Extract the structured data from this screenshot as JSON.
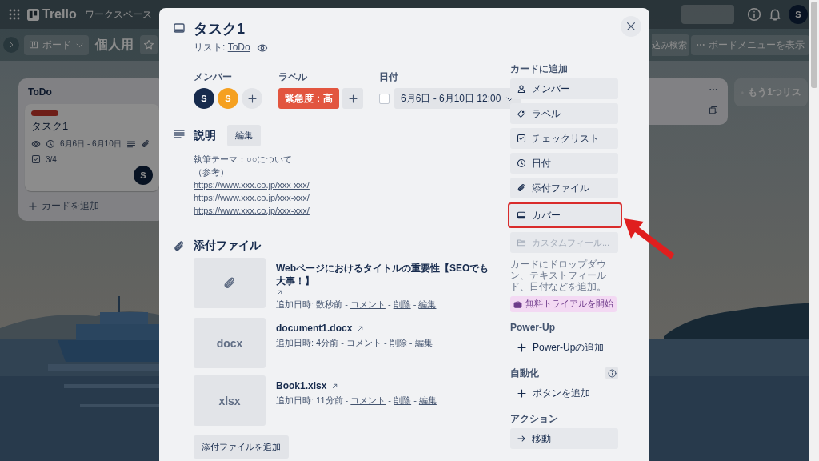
{
  "board": {
    "topbar": {
      "logo": "Trello",
      "workspace": "ワークスペース",
      "avatar": "S"
    },
    "header": {
      "view": "ボード",
      "title": "個人用",
      "filter_button": "込み検索",
      "menu_button": "ボードメニューを表示"
    },
    "lists": [
      {
        "title": "ToDo",
        "cards": [
          {
            "title": "タスク1",
            "dates": "6月6日 - 6月10日",
            "checklist": "3/4",
            "member": "S"
          }
        ],
        "add_card": "カードを追加"
      }
    ],
    "add_list": "もう1つリス"
  },
  "card_dialog": {
    "title": "タスク1",
    "list_prefix": "リスト: ",
    "list_name": "ToDo",
    "members_label": "メンバー",
    "members": [
      {
        "initial": "S",
        "color": "#172b4d"
      },
      {
        "initial": "S",
        "color": "#f5a020"
      }
    ],
    "labels_label": "ラベル",
    "labels": [
      {
        "text": "緊急度：高",
        "color": "#e2553f"
      }
    ],
    "date_label": "日付",
    "date": {
      "checked": false,
      "text": "6月6日 - 6月10日 12:00"
    },
    "description": {
      "title": "説明",
      "edit_button": "編集",
      "lines": [
        {
          "kind": "text",
          "text": "執筆テーマ：○○について"
        },
        {
          "kind": "text",
          "text": "（参考）"
        },
        {
          "kind": "link",
          "text": "https://www.xxx.co.jp/xxx-xxx/"
        },
        {
          "kind": "link",
          "text": "https://www.xxx.co.jp/xxx-xxx/"
        },
        {
          "kind": "link",
          "text": "https://www.xxx.co.jp/xxx-xxx/"
        }
      ]
    },
    "attachments": {
      "title": "添付ファイル",
      "add_button": "添付ファイルを追加",
      "items": [
        {
          "kind": "link",
          "name": "Webページにおけるタイトルの重要性【SEOでも大事！】",
          "meta": [
            {
              "text": "追加日時: 数秒前 - ",
              "link": false
            },
            {
              "text": "コメント",
              "link": true
            },
            {
              "text": " - ",
              "link": false
            },
            {
              "text": "削除",
              "link": true
            },
            {
              "text": " - ",
              "link": false
            },
            {
              "text": "編集",
              "link": true
            }
          ]
        },
        {
          "kind": "file",
          "thumb": "docx",
          "name": "document1.docx",
          "meta": [
            {
              "text": "追加日時: 4分前 - ",
              "link": false
            },
            {
              "text": "コメント",
              "link": true
            },
            {
              "text": " - ",
              "link": false
            },
            {
              "text": "削除",
              "link": true
            },
            {
              "text": " - ",
              "link": false
            },
            {
              "text": "編集",
              "link": true
            }
          ]
        },
        {
          "kind": "file",
          "thumb": "xlsx",
          "name": "Book1.xlsx",
          "meta": [
            {
              "text": "追加日時: 11分前 - ",
              "link": false
            },
            {
              "text": "コメント",
              "link": true
            },
            {
              "text": " - ",
              "link": false
            },
            {
              "text": "削除",
              "link": true
            },
            {
              "text": " - ",
              "link": false
            },
            {
              "text": "編集",
              "link": true
            }
          ]
        }
      ]
    },
    "sidebar": [
      {
        "title": "カードに追加",
        "info": false,
        "items": [
          {
            "kind": "member",
            "label": "メンバー",
            "highlighted": false,
            "disabled": false
          },
          {
            "kind": "label",
            "label": "ラベル",
            "highlighted": false,
            "disabled": false
          },
          {
            "kind": "checklist",
            "label": "チェックリスト",
            "highlighted": false,
            "disabled": false
          },
          {
            "kind": "date",
            "label": "日付",
            "highlighted": false,
            "disabled": false
          },
          {
            "kind": "attachment",
            "label": "添付ファイル",
            "highlighted": false,
            "disabled": false
          },
          {
            "kind": "cover",
            "label": "カバー",
            "highlighted": true,
            "disabled": false
          },
          {
            "kind": "custom-field",
            "label": "カスタムフィール...",
            "highlighted": false,
            "disabled": true
          },
          {
            "kind": "note",
            "label": "カードにドロップダウン、テキストフィールド、日付などを追加。"
          },
          {
            "kind": "trial",
            "label": "無料トライアルを開始"
          }
        ]
      },
      {
        "title": "Power-Up",
        "info": false,
        "items": [
          {
            "kind": "add",
            "label": "Power-Upの追加",
            "highlighted": false,
            "disabled": false
          }
        ]
      },
      {
        "title": "自動化",
        "info": true,
        "items": [
          {
            "kind": "add",
            "label": "ボタンを追加",
            "highlighted": false,
            "disabled": false
          }
        ]
      },
      {
        "title": "アクション",
        "info": false,
        "items": [
          {
            "kind": "move",
            "label": "移動",
            "highlighted": false,
            "disabled": false
          }
        ]
      }
    ]
  }
}
